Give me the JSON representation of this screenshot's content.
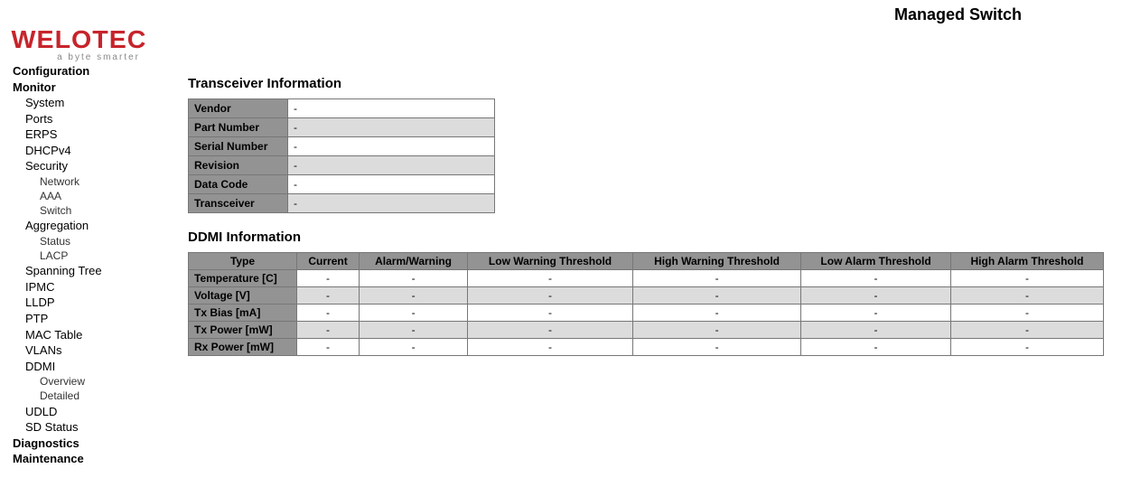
{
  "header": {
    "page_title": "Managed Switch",
    "logo_main": "WELOTEC",
    "logo_tag": "a byte smarter"
  },
  "sidebar": {
    "configuration": "Configuration",
    "monitor": "Monitor",
    "system": "System",
    "ports": "Ports",
    "erps": "ERPS",
    "dhcpv4": "DHCPv4",
    "security": "Security",
    "security_network": "Network",
    "security_aaa": "AAA",
    "security_switch": "Switch",
    "aggregation": "Aggregation",
    "aggregation_status": "Status",
    "aggregation_lacp": "LACP",
    "spanning_tree": "Spanning Tree",
    "ipmc": "IPMC",
    "lldp": "LLDP",
    "ptp": "PTP",
    "mac_table": "MAC Table",
    "vlans": "VLANs",
    "ddmi": "DDMI",
    "ddmi_overview": "Overview",
    "ddmi_detailed": "Detailed",
    "udld": "UDLD",
    "sd_status": "SD Status",
    "diagnostics": "Diagnostics",
    "maintenance": "Maintenance"
  },
  "transceiver": {
    "title": "Transceiver Information",
    "rows": {
      "vendor_label": "Vendor",
      "vendor_value": "-",
      "part_number_label": "Part Number",
      "part_number_value": "-",
      "serial_number_label": "Serial Number",
      "serial_number_value": "-",
      "revision_label": "Revision",
      "revision_value": "-",
      "data_code_label": "Data Code",
      "data_code_value": "-",
      "transceiver_label": "Transceiver",
      "transceiver_value": "-"
    }
  },
  "ddmi_info": {
    "title": "DDMI Information",
    "headers": {
      "type": "Type",
      "current": "Current",
      "alarm_warning": "Alarm/Warning",
      "low_warning": "Low Warning Threshold",
      "high_warning": "High Warning Threshold",
      "low_alarm": "Low Alarm Threshold",
      "high_alarm": "High Alarm Threshold"
    },
    "rows": [
      {
        "type": "Temperature [C]",
        "current": "-",
        "alarm_warning": "-",
        "low_warning": "-",
        "high_warning": "-",
        "low_alarm": "-",
        "high_alarm": "-"
      },
      {
        "type": "Voltage [V]",
        "current": "-",
        "alarm_warning": "-",
        "low_warning": "-",
        "high_warning": "-",
        "low_alarm": "-",
        "high_alarm": "-"
      },
      {
        "type": "Tx Bias [mA]",
        "current": "-",
        "alarm_warning": "-",
        "low_warning": "-",
        "high_warning": "-",
        "low_alarm": "-",
        "high_alarm": "-"
      },
      {
        "type": "Tx Power [mW]",
        "current": "-",
        "alarm_warning": "-",
        "low_warning": "-",
        "high_warning": "-",
        "low_alarm": "-",
        "high_alarm": "-"
      },
      {
        "type": "Rx Power [mW]",
        "current": "-",
        "alarm_warning": "-",
        "low_warning": "-",
        "high_warning": "-",
        "low_alarm": "-",
        "high_alarm": "-"
      }
    ]
  }
}
